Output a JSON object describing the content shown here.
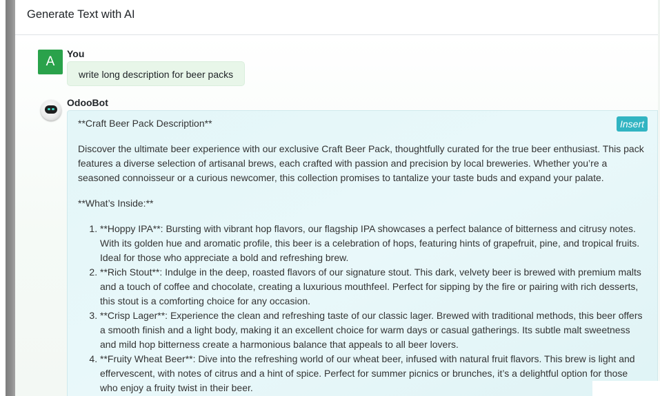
{
  "dialog": {
    "title": "Generate Text with AI"
  },
  "chat": {
    "user": {
      "avatar_letter": "A",
      "author": "You",
      "message": "write long description for beer packs"
    },
    "bot": {
      "author": "OdooBot",
      "insert_label": "Insert",
      "heading": "**Craft Beer Pack Description**",
      "intro": "Discover the ultimate beer experience with our exclusive Craft Beer Pack, thoughtfully curated for the true beer enthusiast. This pack features a diverse selection of artisanal brews, each crafted with passion and precision by local breweries. Whether you’re a seasoned connoisseur or a curious newcomer, this collection promises to tantalize your taste buds and expand your palate.",
      "subheading": "**What’s Inside:**",
      "items": [
        "**Hoppy IPA**: Bursting with vibrant hop flavors, our flagship IPA showcases a perfect balance of bitterness and citrusy notes. With its golden hue and aromatic profile, this beer is a celebration of hops, featuring hints of grapefruit, pine, and tropical fruits. Ideal for those who appreciate a bold and refreshing brew.",
        "**Rich Stout**: Indulge in the deep, roasted flavors of our signature stout. This dark, velvety beer is brewed with premium malts and a touch of coffee and chocolate, creating a luxurious mouthfeel. Perfect for sipping by the fire or pairing with rich desserts, this stout is a comforting choice for any occasion.",
        "**Crisp Lager**: Experience the clean and refreshing taste of our classic lager. Brewed with traditional methods, this beer offers a smooth finish and a light body, making it an excellent choice for warm days or casual gatherings. Its subtle malt sweetness and mild hop bitterness create a harmonious balance that appeals to all beer lovers.",
        "**Fruity Wheat Beer**: Dive into the refreshing world of our wheat beer, infused with natural fruit flavors. This brew is light and effervescent, with notes of citrus and a hint of spice. Perfect for summer picnics or brunches, it’s a delightful option for those who enjoy a fruity twist in their beer."
      ]
    }
  },
  "colors": {
    "user_avatar": "#2aa24b",
    "user_bubble": "#e8f6e9",
    "bot_bubble": "#e3f6f8",
    "insert_button": "#31b4c2"
  },
  "icons": {
    "bot_avatar": "odoobot-robot-icon"
  }
}
